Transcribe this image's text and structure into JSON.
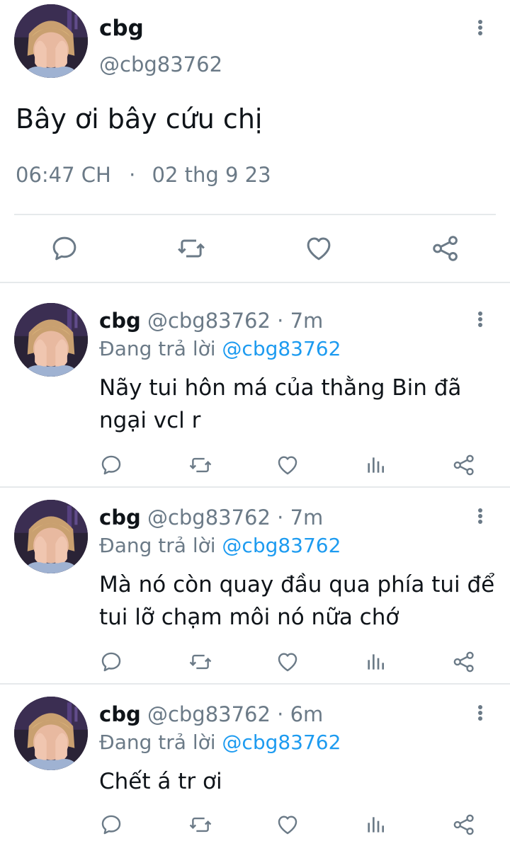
{
  "main_tweet": {
    "name": "cbg",
    "handle": "@cbg83762",
    "text": "Bây ơi bây cứu chị",
    "time": "06:47 CH",
    "separator": "·",
    "date": "02 thg 9 23"
  },
  "replies": [
    {
      "name": "cbg",
      "handle_time": "@cbg83762 · 7m",
      "replying_prefix": "Đang trả lời",
      "replying_to": "@cbg83762",
      "text_line1": "Nãy tui hôn má của thằng Bin đã",
      "text_line2": "ngại vcl r"
    },
    {
      "name": "cbg",
      "handle_time": "@cbg83762 · 7m",
      "replying_prefix": "Đang trả lời",
      "replying_to": "@cbg83762",
      "text_line1": "Mà nó còn quay đầu qua phía tui để",
      "text_line2": "tui lỡ chạm môi nó nữa chớ"
    },
    {
      "name": "cbg",
      "handle_time": "@cbg83762 · 6m",
      "replying_prefix": "Đang trả lời",
      "replying_to": "@cbg83762",
      "text_line1": "Chết á tr ơi",
      "text_line2": ""
    }
  ],
  "icons": {
    "reply": "comment-bubble-icon",
    "retweet": "retweet-arrows-icon",
    "like": "heart-icon",
    "views": "bar-chart-icon",
    "share": "share-nodes-icon",
    "more": "vertical-dots-icon"
  },
  "colors": {
    "text": "#0f1419",
    "secondary": "#6b7a87",
    "link": "#1d9bf0",
    "divider": "#e6e9eb"
  }
}
